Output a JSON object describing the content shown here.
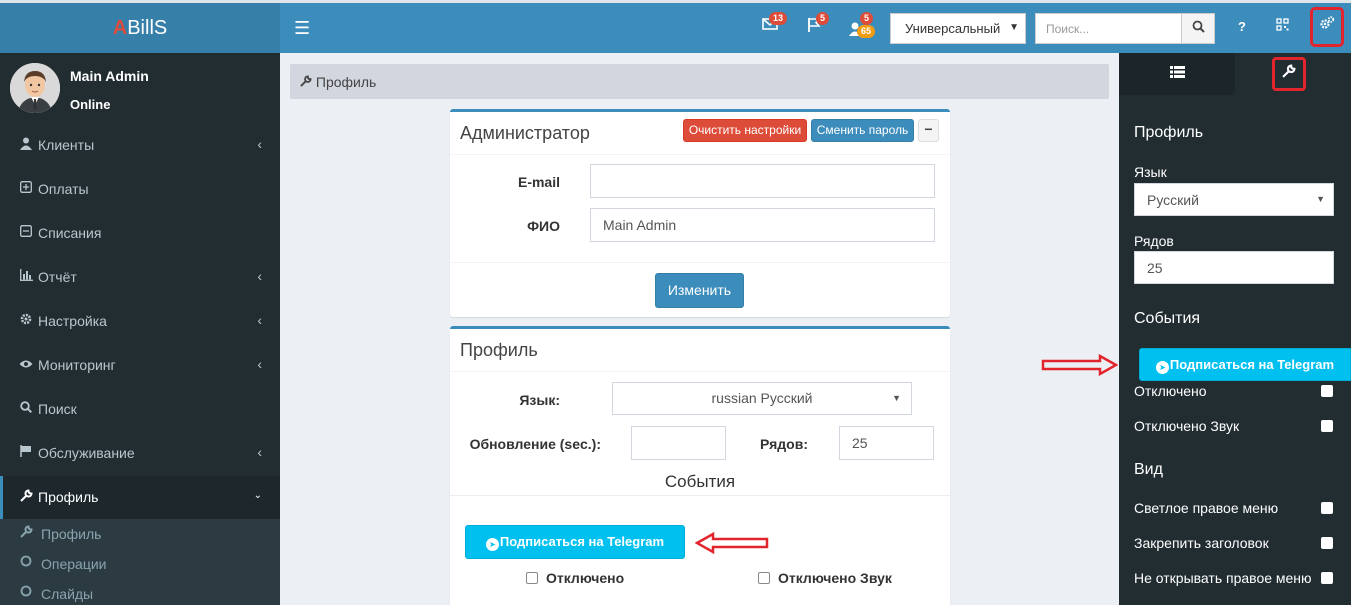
{
  "header": {
    "logo_a": "A",
    "logo_rest": "BillS",
    "mail_badge": "13",
    "flag_badge": "5",
    "user_badge_top": "5",
    "user_badge_bottom": "65",
    "mode_select": "Универсальный",
    "search_placeholder": "Поиск...",
    "help": "?"
  },
  "user": {
    "name": "Main Admin",
    "status": "Online"
  },
  "sidebar": {
    "items": [
      {
        "label": "Клиенты",
        "icon": "user-icon"
      },
      {
        "label": "Оплаты",
        "icon": "plus-square-icon"
      },
      {
        "label": "Списания",
        "icon": "minus-square-icon"
      },
      {
        "label": "Отчёт",
        "icon": "bar-chart-icon"
      },
      {
        "label": "Настройка",
        "icon": "gear-icon"
      },
      {
        "label": "Мониторинг",
        "icon": "eye-icon"
      },
      {
        "label": "Поиск",
        "icon": "search-icon"
      },
      {
        "label": "Обслуживание",
        "icon": "flag-icon"
      },
      {
        "label": "Профиль",
        "icon": "wrench-icon"
      }
    ],
    "sub_items": [
      {
        "label": "Профиль"
      },
      {
        "label": "Операции"
      },
      {
        "label": "Слайды"
      }
    ]
  },
  "breadcrumb": "Профиль",
  "admin_box": {
    "title": "Администратор",
    "clear_btn": "Очистить настройки",
    "change_pass_btn": "Сменить пароль",
    "minimize": "−",
    "email_label": "E-mail",
    "email_value": "",
    "fio_label": "ФИО",
    "fio_value": "Main Admin",
    "submit": "Изменить"
  },
  "profile_box": {
    "title": "Профиль",
    "lang_label": "Язык:",
    "lang_value": "russian Русский",
    "refresh_label": "Обновление (sec.):",
    "refresh_value": "",
    "rows_label": "Рядов:",
    "rows_value": "25",
    "events_head": "События",
    "telegram_btn": "Подписаться на Telegram",
    "disabled_label": "Отключено",
    "disabled_sound_label": "Отключено Звук"
  },
  "control": {
    "profile_head": "Профиль",
    "lang_label": "Язык",
    "lang_value": "Русский",
    "rows_label": "Рядов",
    "rows_value": "25",
    "events_head": "События",
    "telegram_btn": "Подписаться на Telegram",
    "disabled_label": "Отключено",
    "disabled_sound_label": "Отключено Звук",
    "view_head": "Вид",
    "light_menu_label": "Светлое правое меню",
    "fix_header_label": "Закрепить заголовок",
    "no_open_right_label": "Не открывать правое меню"
  },
  "colors": {
    "navbar": "#3c8dbc",
    "sidebar": "#222d32",
    "annotation": "#e2242c",
    "info": "#00c0ef",
    "danger": "#dd4b39"
  }
}
